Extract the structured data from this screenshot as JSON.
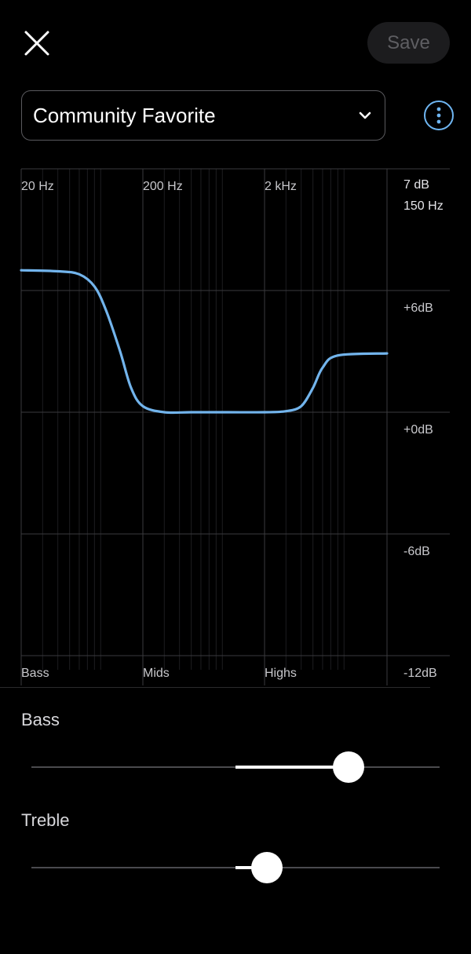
{
  "header": {
    "save_label": "Save"
  },
  "preset": {
    "selected": "Community Favorite"
  },
  "colors": {
    "accent": "#6fb6f2",
    "curve": "#72b4ec",
    "background": "#000000"
  },
  "chart_data": {
    "type": "line",
    "x_scale": "log",
    "x_ticks": [
      {
        "label": "20 Hz",
        "value": 20
      },
      {
        "label": "200 Hz",
        "value": 200
      },
      {
        "label": "2 kHz",
        "value": 2000
      }
    ],
    "band_labels": [
      "Bass",
      "Mids",
      "Highs"
    ],
    "y_ticks": [
      {
        "label": "+6dB",
        "value": 6
      },
      {
        "label": "+0dB",
        "value": 0
      },
      {
        "label": "-6dB",
        "value": -6
      },
      {
        "label": "-12dB",
        "value": -12
      }
    ],
    "ylim": [
      -12,
      12
    ],
    "readout": {
      "gain": "7 dB",
      "freq": "150 Hz"
    },
    "series": [
      {
        "x": [
          20,
          40,
          60,
          80,
          100,
          130,
          160,
          200,
          300,
          500,
          1000,
          2000,
          3000,
          4000,
          5000,
          6000,
          8000,
          12000
        ],
        "y": [
          7,
          6.95,
          6.8,
          6.2,
          5,
          3,
          1.2,
          0.3,
          0,
          0,
          0,
          0,
          0.05,
          0.3,
          1.2,
          2.2,
          2.8,
          2.9
        ]
      }
    ]
  },
  "bass": {
    "label": "Bass",
    "value": 0.776
  },
  "treble": {
    "label": "Treble",
    "value": 0.577
  }
}
